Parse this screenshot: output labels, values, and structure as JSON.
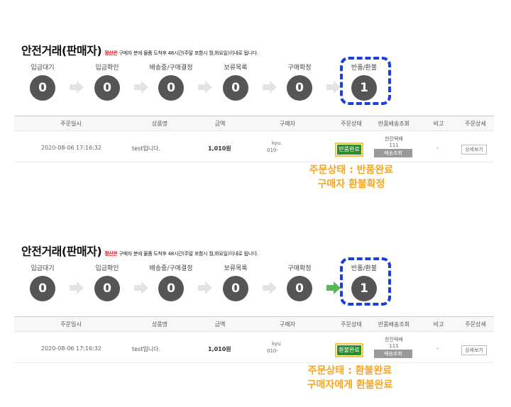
{
  "panels": [
    {
      "title": "안전거래(판매자)",
      "notice_red": "정산은",
      "notice_rest": "구매자 분에 물품 도착후 48시간(주말 포함시 월,화요일)이내로 됩니다.",
      "steps": [
        {
          "label": "입금대기",
          "count": "0"
        },
        {
          "label": "입금확인",
          "count": "0"
        },
        {
          "label": "배송중/구매결정",
          "count": "0"
        },
        {
          "label": "보류목록",
          "count": "0"
        },
        {
          "label": "구매확정",
          "count": "0"
        },
        {
          "label": "반품/환불",
          "count": "1"
        }
      ],
      "columns": [
        "주문일시",
        "상품명",
        "금액",
        "구매자",
        "주문상태",
        "반품배송조회",
        "비고",
        "주문상세"
      ],
      "row": {
        "date": "2020-08-06 17:16:32",
        "product": "test입니다.",
        "price": "1,010원",
        "buyer_line1": "kyu",
        "buyer_line2": "010-",
        "status": "반품완료",
        "courier": "한진택배",
        "tracking": "111",
        "delivery_button": "배송조회",
        "remark": "-",
        "detail_button": "상세보기"
      },
      "note_line1": "주문상태 : 반품완료",
      "note_line2": "구매자 환불확정"
    },
    {
      "title": "안전거래(판매자)",
      "notice_red": "정산은",
      "notice_rest": "구매자 분에 물품 도착후 48시간(주말 포함시 월,화요일)이내로 됩니다.",
      "steps": [
        {
          "label": "입금대기",
          "count": "0"
        },
        {
          "label": "입금확인",
          "count": "0"
        },
        {
          "label": "배송중/구매결정",
          "count": "0"
        },
        {
          "label": "보류목록",
          "count": "0"
        },
        {
          "label": "구매확정",
          "count": "0"
        },
        {
          "label": "반품/환불",
          "count": "1"
        }
      ],
      "columns": [
        "주문일시",
        "상품명",
        "금액",
        "구매자",
        "주문상태",
        "반품배송조회",
        "비고",
        "주문상세"
      ],
      "row": {
        "date": "2020-08-06 17:16:32",
        "product": "test입니다.",
        "price": "1,010원",
        "buyer_line1": "kyu",
        "buyer_line2": "010-",
        "status": "환불완료",
        "courier": "한진택배",
        "tracking": "111",
        "delivery_button": "배송조회",
        "remark": "-",
        "detail_button": "상세보기"
      },
      "note_line1": "주문상태 : 환불완료",
      "note_line2": "구매자에게 환불완료"
    }
  ],
  "colors": {
    "status_green": "#2e8b2e",
    "highlight_yellow": "#f5c542",
    "dash_blue": "#1a3de6",
    "note_orange": "#f6a623",
    "notice_red": "#e60012"
  }
}
